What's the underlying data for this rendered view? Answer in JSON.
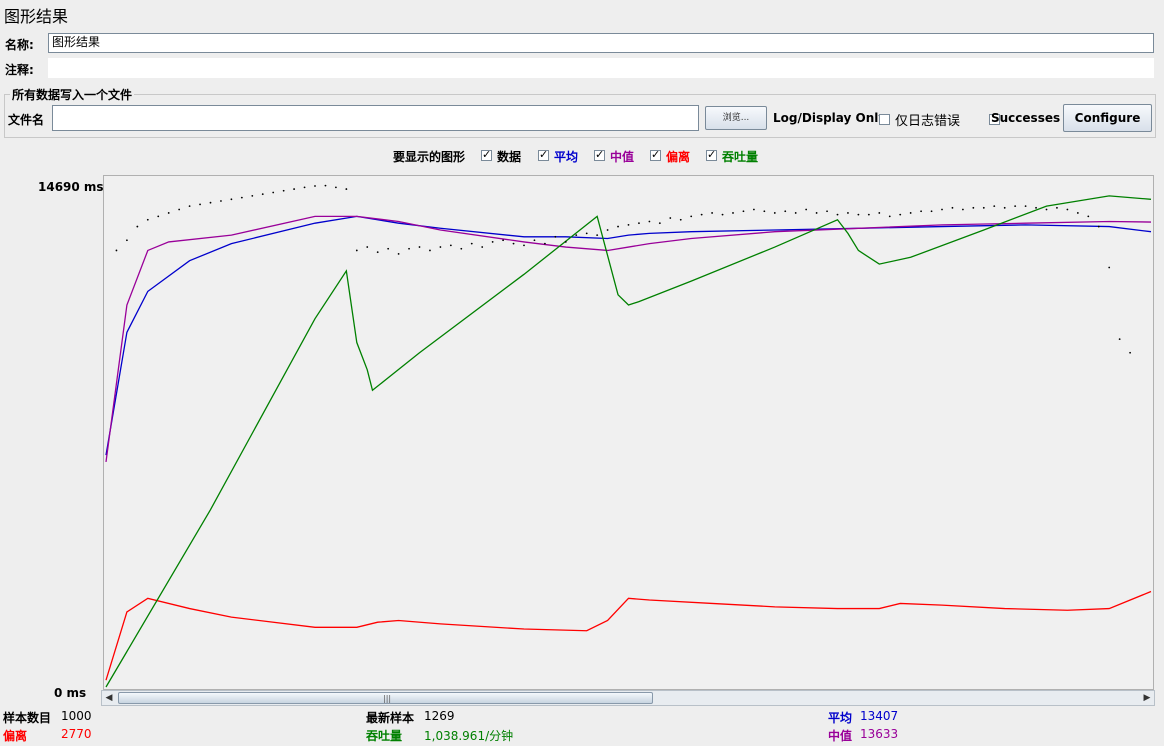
{
  "window": {
    "title": "图形结果"
  },
  "form": {
    "name_label": "名称:",
    "name_value": "图形结果",
    "comment_label": "注释:",
    "comment_value": ""
  },
  "file_section": {
    "legend": "所有数据写入一个文件",
    "filename_label": "文件名",
    "filename_value": "",
    "browse_label": "浏览...",
    "log_display_label": "Log/Display Only:",
    "errors_only_label": "仅日志错误",
    "successes_label": "Successes",
    "configure_label": "Configure"
  },
  "graphs": {
    "label": "要显示的图形",
    "items": [
      {
        "label": "数据",
        "checked": true,
        "color": "#000000"
      },
      {
        "label": "平均",
        "checked": true,
        "color": "#0000cc"
      },
      {
        "label": "中值",
        "checked": true,
        "color": "#990099"
      },
      {
        "label": "偏离",
        "checked": true,
        "color": "#ff0000"
      },
      {
        "label": "吞吐量",
        "checked": true,
        "color": "#008000"
      }
    ]
  },
  "chart_data": {
    "type": "line",
    "ymax_label": "14690 ms",
    "ymin_label": "0 ms",
    "ylim": [
      0,
      14690
    ],
    "series": [
      {
        "name": "平均",
        "color": "#0000cc",
        "x": [
          0,
          20,
          40,
          80,
          120,
          200,
          240,
          280,
          320,
          400,
          440,
          480,
          500,
          520,
          560,
          640,
          720,
          800,
          880,
          960,
          1000
        ],
        "y": [
          6800,
          10400,
          11600,
          12500,
          13000,
          13600,
          13800,
          13600,
          13450,
          13200,
          13200,
          13150,
          13250,
          13300,
          13350,
          13400,
          13450,
          13500,
          13550,
          13500,
          13350
        ]
      },
      {
        "name": "中值",
        "color": "#990099",
        "x": [
          0,
          20,
          40,
          60,
          120,
          200,
          240,
          280,
          320,
          400,
          440,
          480,
          500,
          520,
          560,
          640,
          720,
          800,
          880,
          960,
          1000
        ],
        "y": [
          6600,
          11200,
          12800,
          13050,
          13250,
          13800,
          13800,
          13650,
          13400,
          13050,
          12900,
          12800,
          12900,
          13000,
          13150,
          13350,
          13450,
          13550,
          13600,
          13650,
          13633
        ]
      },
      {
        "name": "偏离",
        "color": "#ff0000",
        "x": [
          0,
          20,
          40,
          80,
          120,
          200,
          240,
          260,
          280,
          320,
          400,
          460,
          480,
          500,
          520,
          580,
          640,
          700,
          740,
          760,
          800,
          860,
          920,
          960,
          1000
        ],
        "y": [
          200,
          2200,
          2600,
          2300,
          2050,
          1750,
          1750,
          1900,
          1950,
          1850,
          1700,
          1650,
          1950,
          2600,
          2550,
          2450,
          2350,
          2300,
          2300,
          2450,
          2400,
          2300,
          2250,
          2300,
          2800
        ]
      },
      {
        "name": "吞吐量",
        "color": "#008000",
        "x": [
          0,
          100,
          200,
          230,
          240,
          250,
          255,
          300,
          400,
          470,
          490,
          500,
          510,
          560,
          640,
          700,
          710,
          720,
          740,
          770,
          840,
          900,
          960,
          1000
        ],
        "y": [
          0,
          5200,
          10800,
          12200,
          10100,
          9300,
          8700,
          9800,
          12100,
          13800,
          11500,
          11200,
          11300,
          11900,
          12900,
          13700,
          13300,
          12800,
          12400,
          12600,
          13400,
          14100,
          14400,
          14300
        ]
      },
      {
        "name": "数据",
        "color": "#000000",
        "x": [
          10,
          20,
          30,
          40,
          50,
          60,
          70,
          80,
          90,
          100,
          110,
          120,
          130,
          140,
          150,
          160,
          170,
          180,
          190,
          200,
          210,
          220,
          230,
          240,
          250,
          260,
          270,
          280,
          290,
          300,
          310,
          320,
          330,
          340,
          350,
          360,
          370,
          380,
          390,
          400,
          410,
          420,
          430,
          440,
          450,
          460,
          470,
          480,
          490,
          500,
          510,
          520,
          530,
          540,
          550,
          560,
          570,
          580,
          590,
          600,
          610,
          620,
          630,
          640,
          650,
          660,
          670,
          680,
          690,
          700,
          710,
          720,
          730,
          740,
          750,
          760,
          770,
          780,
          790,
          800,
          810,
          820,
          830,
          840,
          850,
          860,
          870,
          880,
          890,
          900,
          910,
          920,
          930,
          940,
          950,
          960,
          970,
          980
        ],
        "y": [
          12800,
          13100,
          13500,
          13700,
          13800,
          13900,
          14000,
          14100,
          14150,
          14200,
          14250,
          14300,
          14350,
          14400,
          14450,
          14500,
          14550,
          14600,
          14650,
          14690,
          14700,
          14650,
          14600,
          12800,
          12900,
          12750,
          12850,
          12700,
          12850,
          12900,
          12800,
          12900,
          12950,
          12850,
          13000,
          12900,
          13050,
          13100,
          13000,
          12950,
          13100,
          13000,
          13200,
          13050,
          13250,
          13300,
          13250,
          13400,
          13500,
          13550,
          13600,
          13650,
          13600,
          13750,
          13700,
          13800,
          13850,
          13900,
          13850,
          13900,
          13950,
          14000,
          13950,
          13900,
          13950,
          13900,
          14000,
          13900,
          13950,
          13850,
          13900,
          13850,
          13850,
          13900,
          13800,
          13850,
          13900,
          13950,
          13950,
          14000,
          14050,
          14000,
          14050,
          14050,
          14100,
          14050,
          14100,
          14100,
          14050,
          14000,
          14050,
          14000,
          13900,
          13800,
          13500,
          12300,
          10200,
          9800
        ]
      }
    ]
  },
  "stats": {
    "samples_label": "样本数目",
    "samples_value": "1000",
    "latest_label": "最新样本",
    "latest_value": "1269",
    "average_label": "平均",
    "average_value": "13407",
    "deviation_label": "偏离",
    "deviation_value": "2770",
    "throughput_label": "吞吐量",
    "throughput_value": "1,038.961/分钟",
    "median_label": "中值",
    "median_value": "13633"
  }
}
